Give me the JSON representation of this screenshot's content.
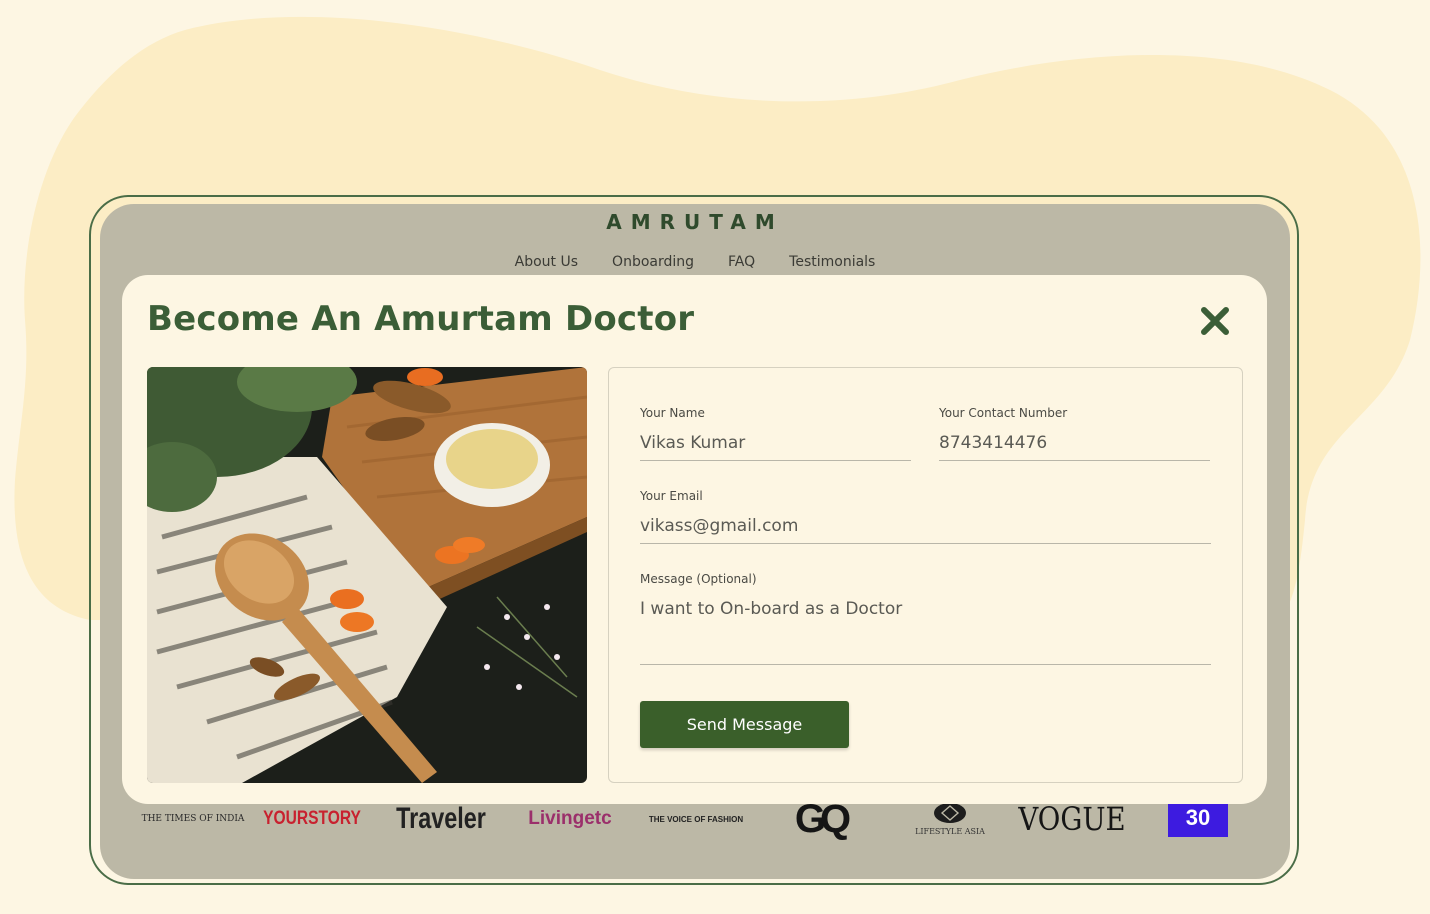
{
  "site": {
    "brand": "AMRUTAM",
    "nav": [
      "About Us",
      "Onboarding",
      "FAQ",
      "Testimonials"
    ]
  },
  "press_logos": [
    "THE TIMES OF INDIA",
    "YOURSTORY",
    "Traveler",
    "Livingetc",
    "THE VOICE OF FASHION",
    "GQ",
    "LIFESTYLE ASIA",
    "VOGUE",
    "30"
  ],
  "modal": {
    "title": "Become An Amurtam Doctor",
    "close_icon": "close-icon",
    "form": {
      "name_label": "Your Name",
      "name_value": "Vikas Kumar",
      "contact_label": "Your Contact Number",
      "contact_value": "8743414476",
      "email_label": "Your Email",
      "email_value": "vikass@gmail.com",
      "message_label": "Message (Optional)",
      "message_value": "I want to On-board as a Doctor",
      "submit_label": "Send Message"
    }
  },
  "colors": {
    "background": "#fdf6e3",
    "blob": "#fcedc5",
    "accent": "#3a5f2a",
    "title": "#3b5e37",
    "overlay": "#bcb8a6"
  }
}
